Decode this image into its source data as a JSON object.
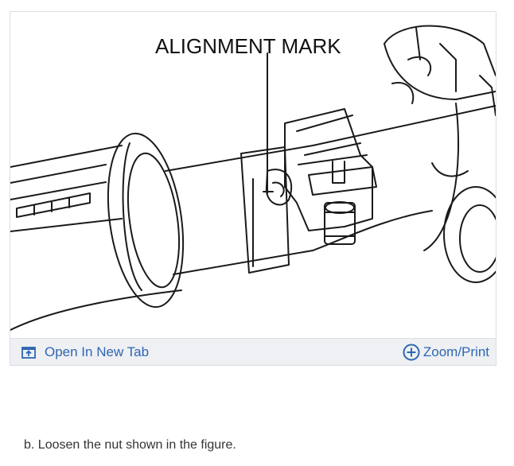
{
  "figure": {
    "label_text": "ALIGNMENT MARK",
    "toolbar": {
      "open_tab_label": "Open In New Tab",
      "open_tab_icon": "open-in-new-tab-icon",
      "zoom_label": "Zoom/Print",
      "zoom_icon": "zoom-plus-icon",
      "link_color": "#2f66b2",
      "toolbar_bg": "#eef0f3"
    }
  },
  "step_text": "b. Loosen the nut shown in the figure."
}
